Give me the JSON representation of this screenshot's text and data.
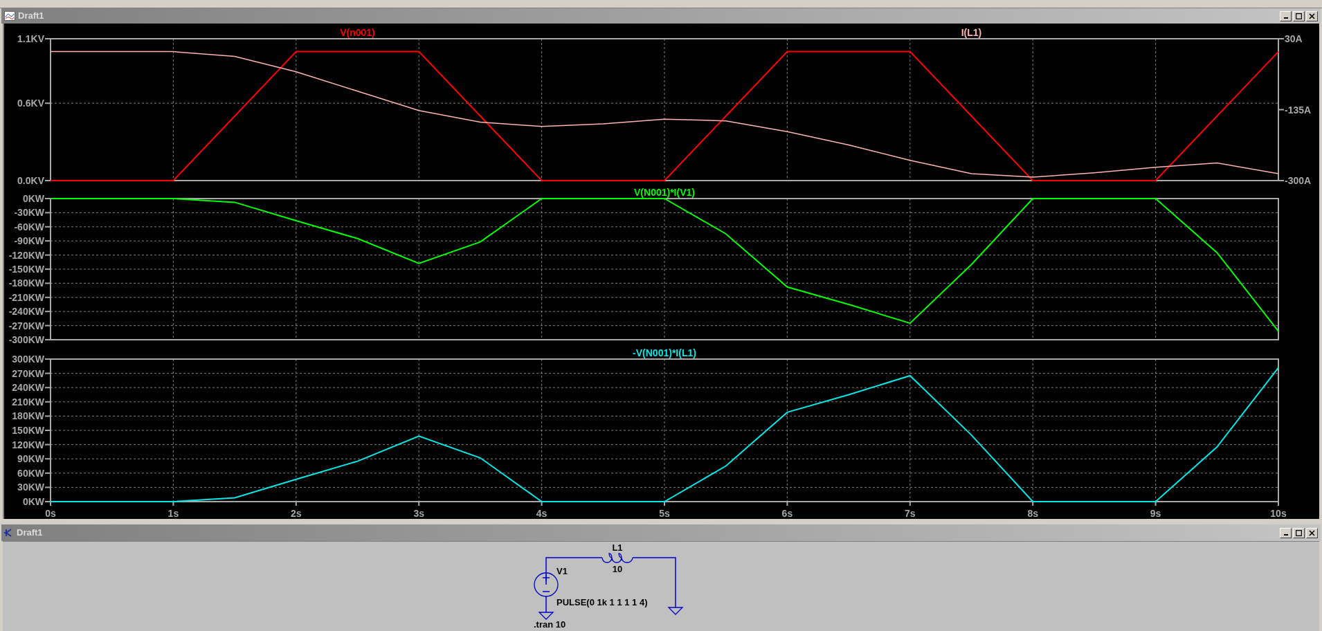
{
  "plot_window": {
    "title": "Draft1",
    "panes": [
      {
        "chart_data": {
          "type": "line",
          "grid": true,
          "x": [
            0,
            0.5,
            1,
            1.5,
            2,
            2.5,
            3,
            3.5,
            4,
            4.5,
            5,
            5.5,
            6,
            6.5,
            7,
            7.5,
            8,
            8.5,
            9,
            9.5,
            10
          ],
          "xlim": [
            0,
            10
          ],
          "ylim": [
            0,
            1.1
          ],
          "yticks": [
            {
              "value": 1.1,
              "label": "1.1KV"
            },
            {
              "value": 0.6,
              "label": "0.6KV"
            },
            {
              "value": 0,
              "label": "0.0KV"
            }
          ],
          "y2lim": [
            -300,
            30
          ],
          "y2ticks": [
            {
              "value": 30,
              "label": "30A"
            },
            {
              "value": -135,
              "label": "-135A"
            },
            {
              "value": -300,
              "label": "-300A"
            }
          ],
          "series": [
            {
              "name": "V(n001)",
              "color": "#ff0000",
              "values": [
                0,
                0,
                0,
                0.5,
                1,
                1,
                1,
                0.5,
                0,
                0,
                0,
                0.5,
                1,
                1,
                1,
                0.5,
                0,
                0,
                0,
                0.5,
                1
              ]
            },
            {
              "name": "I(L1)",
              "color": "#ffb4b4",
              "axis": "y2",
              "values": [
                0,
                0,
                0,
                -11,
                -47,
                -92,
                -137,
                -164,
                -174,
                -168,
                -157,
                -161,
                -186,
                -217,
                -253,
                -284,
                -292,
                -282,
                -269,
                -259,
                -284
              ]
            }
          ]
        }
      },
      {
        "chart_data": {
          "type": "line",
          "grid": true,
          "x": [
            0,
            0.5,
            1,
            1.5,
            2,
            2.5,
            3,
            3.5,
            4,
            4.5,
            5,
            5.5,
            6,
            6.5,
            7,
            7.5,
            8,
            8.5,
            9,
            9.5,
            10
          ],
          "xlim": [
            0,
            10
          ],
          "ylim": [
            -300,
            0
          ],
          "yticks": [
            {
              "value": 0,
              "label": "0KW"
            },
            {
              "value": -30,
              "label": "-30KW"
            },
            {
              "value": -60,
              "label": "-60KW"
            },
            {
              "value": -90,
              "label": "-90KW"
            },
            {
              "value": -120,
              "label": "-120KW"
            },
            {
              "value": -150,
              "label": "-150KW"
            },
            {
              "value": -180,
              "label": "-180KW"
            },
            {
              "value": -210,
              "label": "-210KW"
            },
            {
              "value": -240,
              "label": "-240KW"
            },
            {
              "value": -270,
              "label": "-270KW"
            },
            {
              "value": -300,
              "label": "-300KW"
            }
          ],
          "series": [
            {
              "name": "V(N001)*I(V1)",
              "color": "#00ff00",
              "values": [
                0,
                0,
                0,
                -8,
                -47,
                -85,
                -138,
                -92,
                0,
                0,
                0,
                -75,
                -188,
                -225,
                -265,
                -140,
                0,
                0,
                0,
                -115,
                -282
              ]
            }
          ]
        }
      },
      {
        "chart_data": {
          "type": "line",
          "grid": true,
          "x": [
            0,
            0.5,
            1,
            1.5,
            2,
            2.5,
            3,
            3.5,
            4,
            4.5,
            5,
            5.5,
            6,
            6.5,
            7,
            7.5,
            8,
            8.5,
            9,
            9.5,
            10
          ],
          "xlim": [
            0,
            10
          ],
          "ylim": [
            0,
            300
          ],
          "yticks": [
            {
              "value": 300,
              "label": "300KW"
            },
            {
              "value": 270,
              "label": "270KW"
            },
            {
              "value": 240,
              "label": "240KW"
            },
            {
              "value": 210,
              "label": "210KW"
            },
            {
              "value": 180,
              "label": "180KW"
            },
            {
              "value": 150,
              "label": "150KW"
            },
            {
              "value": 120,
              "label": "120KW"
            },
            {
              "value": 90,
              "label": "90KW"
            },
            {
              "value": 60,
              "label": "60KW"
            },
            {
              "value": 30,
              "label": "30KW"
            },
            {
              "value": 0,
              "label": "0KW"
            }
          ],
          "xticks": [
            {
              "value": 0,
              "label": "0s"
            },
            {
              "value": 1,
              "label": "1s"
            },
            {
              "value": 2,
              "label": "2s"
            },
            {
              "value": 3,
              "label": "3s"
            },
            {
              "value": 4,
              "label": "4s"
            },
            {
              "value": 5,
              "label": "5s"
            },
            {
              "value": 6,
              "label": "6s"
            },
            {
              "value": 7,
              "label": "7s"
            },
            {
              "value": 8,
              "label": "8s"
            },
            {
              "value": 9,
              "label": "9s"
            },
            {
              "value": 10,
              "label": "10s"
            }
          ],
          "series": [
            {
              "name": "-V(N001)*I(L1)",
              "color": "#00e8e8",
              "values": [
                0,
                0,
                0,
                8,
                47,
                85,
                138,
                92,
                0,
                0,
                0,
                75,
                188,
                225,
                265,
                140,
                0,
                0,
                0,
                115,
                282
              ]
            }
          ]
        }
      }
    ]
  },
  "schematic_window": {
    "title": "Draft1",
    "source": {
      "name": "V1",
      "value": "PULSE(0 1k 1 1 1 1 4)"
    },
    "inductor": {
      "name": "L1",
      "value": "10"
    },
    "directive": ".tran 10"
  }
}
